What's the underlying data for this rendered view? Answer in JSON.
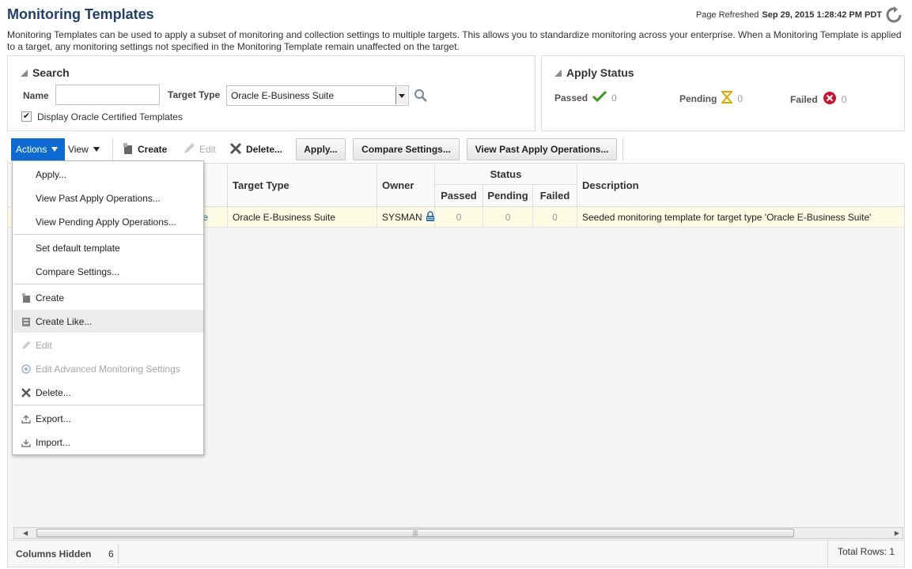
{
  "header": {
    "title": "Monitoring Templates",
    "refreshed_label": "Page Refreshed",
    "refreshed_time": "Sep 29, 2015 1:28:42 PM PDT"
  },
  "intro": "Monitoring Templates can be used to apply a subset of monitoring and collection settings to multiple targets. This allows you to standardize monitoring across your enterprise. When a Monitoring Template is applied to a target, any monitoring settings not specified in the Monitoring Template remain unaffected on the target.",
  "search": {
    "title": "Search",
    "name_label": "Name",
    "name_value": "",
    "target_type_label": "Target Type",
    "target_type_value": "Oracle E-Business Suite",
    "certified_label": "Display Oracle Certified Templates",
    "certified_checked": true
  },
  "apply_status": {
    "title": "Apply Status",
    "passed_label": "Passed",
    "passed_count": "0",
    "pending_label": "Pending",
    "pending_count": "0",
    "failed_label": "Failed",
    "failed_count": "0"
  },
  "toolbar": {
    "actions": "Actions",
    "view": "View",
    "create": "Create",
    "edit": "Edit",
    "delete": "Delete...",
    "apply": "Apply...",
    "compare": "Compare Settings...",
    "past_ops": "View Past Apply Operations..."
  },
  "table": {
    "headers": {
      "target_type": "Target Type",
      "owner": "Owner",
      "status": "Status",
      "passed": "Passed",
      "pending": "Pending",
      "failed": "Failed",
      "description": "Description"
    },
    "rows": [
      {
        "name_fragment": "e",
        "target_type": "Oracle E-Business Suite",
        "owner": "SYSMAN",
        "passed": "0",
        "pending": "0",
        "failed": "0",
        "description": "Seeded monitoring template for target type 'Oracle E-Business Suite'"
      }
    ]
  },
  "footer": {
    "columns_hidden_label": "Columns Hidden",
    "columns_hidden_value": "6",
    "total_rows": "Total Rows: 1"
  },
  "actions_menu": {
    "items": [
      {
        "label": "Apply...",
        "icon": "none",
        "enabled": true
      },
      {
        "label": "View Past Apply Operations...",
        "icon": "none",
        "enabled": true
      },
      {
        "label": "View Pending Apply Operations...",
        "icon": "none",
        "enabled": true
      },
      {
        "label": "Set default template",
        "icon": "none",
        "enabled": true
      },
      {
        "label": "Compare Settings...",
        "icon": "none",
        "enabled": true
      },
      {
        "label": "Create",
        "icon": "create-icon",
        "enabled": true
      },
      {
        "label": "Create Like...",
        "icon": "create-like-icon",
        "enabled": true,
        "highlighted": true
      },
      {
        "label": "Edit",
        "icon": "pencil-icon",
        "enabled": false
      },
      {
        "label": "Edit Advanced Monitoring Settings",
        "icon": "target-icon",
        "enabled": false
      },
      {
        "label": "Delete...",
        "icon": "x-icon",
        "enabled": true
      },
      {
        "label": "Export...",
        "icon": "export-icon",
        "enabled": true
      },
      {
        "label": "Import...",
        "icon": "import-icon",
        "enabled": true
      }
    ]
  },
  "colors": {
    "title_blue": "#1f3f6e",
    "actions_blue": "#0e6bd3",
    "row_highlight": "#fdfbe3",
    "passed_green": "#3a9a1f",
    "pending_amber": "#e0a800",
    "failed_red": "#d0112b"
  }
}
